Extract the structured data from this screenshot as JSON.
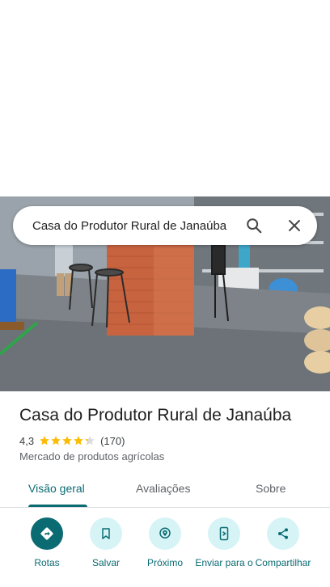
{
  "search": {
    "query": "Casa do Produtor Rural de Janaúba"
  },
  "place": {
    "name": "Casa do Produtor Rural de Janaúba",
    "rating": "4,3",
    "star_fraction": 4.3,
    "reviews": "(170)",
    "category": "Mercado de produtos agrícolas"
  },
  "tabs": [
    {
      "label": "Visão geral",
      "active": true
    },
    {
      "label": "Avaliações",
      "active": false
    },
    {
      "label": "Sobre",
      "active": false
    }
  ],
  "actions": [
    {
      "label": "Rotas",
      "icon": "directions-icon"
    },
    {
      "label": "Salvar",
      "icon": "bookmark-icon"
    },
    {
      "label": "Próximo",
      "icon": "nearby-icon"
    },
    {
      "label": "Enviar para o",
      "icon": "send-to-phone-icon"
    },
    {
      "label": "Compartilhar",
      "icon": "share-icon"
    }
  ],
  "colors": {
    "accent": "#0b6b73",
    "action_bg": "#d6f3f6",
    "star": "#fbbc04"
  }
}
